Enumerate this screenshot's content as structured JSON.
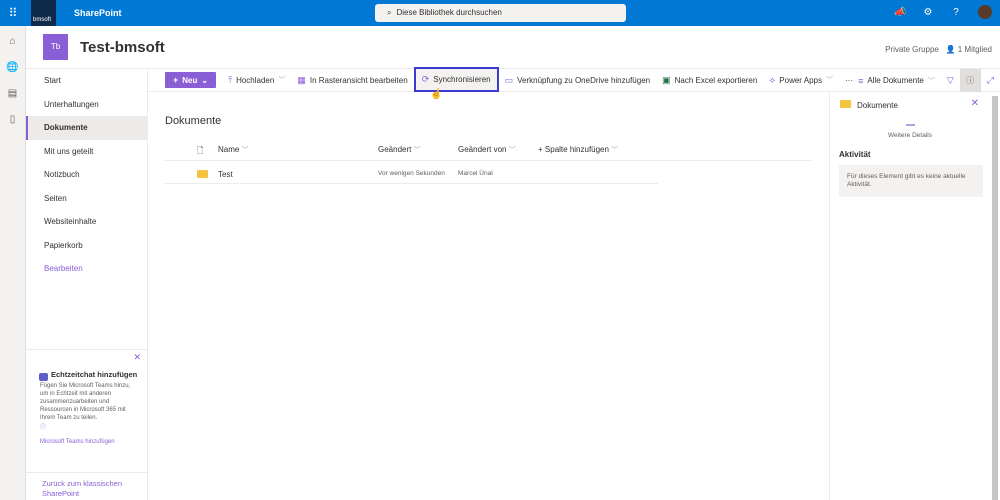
{
  "topbar": {
    "logo": "bmsoft",
    "app": "SharePoint",
    "search_placeholder": "Diese Bibliothek durchsuchen"
  },
  "site": {
    "logo": "Tb",
    "title": "Test-bmsoft",
    "privacy": "Private Gruppe",
    "members": "1 Mitglied"
  },
  "nav": {
    "items": [
      "Start",
      "Unterhaltungen",
      "Dokumente",
      "Mit uns geteilt",
      "Notizbuch",
      "Seiten",
      "Websiteinhalte",
      "Papierkorb",
      "Bearbeiten"
    ],
    "teams_title": "Echtzeitchat hinzufügen",
    "teams_text": "Fügen Sie Microsoft Teams hinzu, um in Echtzeit mit anderen zusammenzuarbeiten und Ressourcen in Microsoft 365 mit Ihrem Team zu teilen.",
    "teams_link": "Microsoft Teams hinzufügen",
    "classic": "Zurück zum klassischen SharePoint"
  },
  "commands": {
    "new": "Neu",
    "upload": "Hochladen",
    "grid": "In Rasteransicht bearbeiten",
    "sync": "Synchronisieren",
    "shortcut": "Verknüpfung zu OneDrive hinzufügen",
    "excel": "Nach Excel exportieren",
    "powerapps": "Power Apps",
    "more": "···",
    "view": "Alle Dokumente"
  },
  "library": {
    "title": "Dokumente",
    "columns": {
      "name": "Name",
      "modified": "Geändert",
      "modified_by": "Geändert von",
      "add_column": "Spalte hinzufügen"
    },
    "rows": [
      {
        "name": "Test",
        "modified": "Vor wenigen Sekunden",
        "modified_by": "Marcel Ünal"
      }
    ]
  },
  "panel": {
    "title": "Dokumente",
    "more": "Weitere Details",
    "activity": "Aktivität",
    "activity_text": "Für dieses Element gibt es keine aktuelle Aktivität."
  },
  "colors": {
    "brand": "#0078d4",
    "accent": "#8a5fd6",
    "highlight": "#3b3bcf"
  }
}
